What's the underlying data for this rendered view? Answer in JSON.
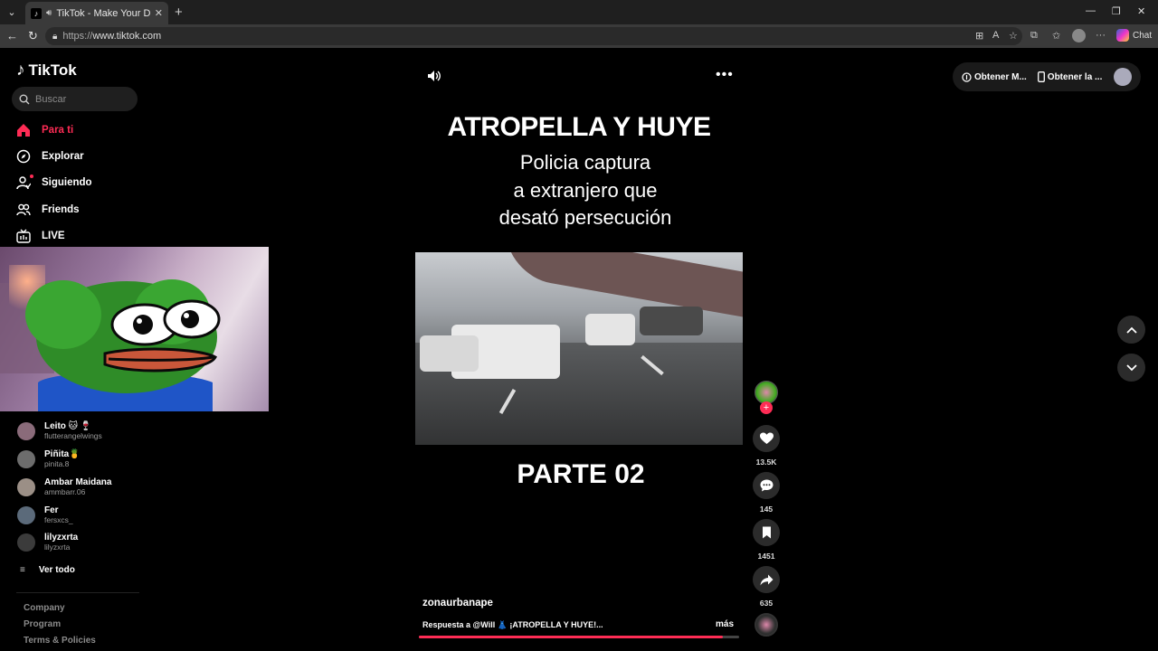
{
  "browser": {
    "tab_title": "TikTok - Make Your Day",
    "url_scheme": "https://",
    "url_host": "www.tiktok.com",
    "chat_label": "Chat"
  },
  "sidebar": {
    "logo": "TikTok",
    "search_placeholder": "Buscar",
    "nav": [
      {
        "label": "Para ti",
        "icon": "home-icon",
        "active": true
      },
      {
        "label": "Explorar",
        "icon": "compass-icon"
      },
      {
        "label": "Siguiendo",
        "icon": "following-icon"
      },
      {
        "label": "Friends",
        "icon": "friends-icon"
      },
      {
        "label": "LIVE",
        "icon": "live-icon"
      }
    ],
    "following": [
      {
        "name": "Leito 🐱 🍷",
        "handle": "flutterangelwings"
      },
      {
        "name": "Piñita🍍",
        "handle": "pinita.8"
      },
      {
        "name": "Ambar Maidana",
        "handle": "ammbarr.06"
      },
      {
        "name": "Fer",
        "handle": "fersxcs_"
      },
      {
        "name": "lilyzxrta",
        "handle": "lilyzxrta"
      }
    ],
    "see_all": "Ver todo",
    "footer": [
      "Company",
      "Program",
      "Terms & Policies"
    ]
  },
  "video": {
    "headline": "ATROPELLA Y HUYE",
    "sub_lines": [
      "Policia captura",
      "a extranjero que",
      "desató persecución"
    ],
    "part_label": "PARTE 02",
    "author": "zonaurbanape",
    "caption": "Respuesta a @Will 👗 ¡ATROPELLA Y HUYE!...",
    "more_label": "más",
    "progress": 0.95
  },
  "actions": {
    "likes": "13.5K",
    "comments": "145",
    "saves": "1451",
    "shares": "635"
  },
  "top_right": {
    "btn1": "Obtener M...",
    "btn2": "Obtener la ..."
  },
  "colors": {
    "accent": "#fe2c55"
  }
}
